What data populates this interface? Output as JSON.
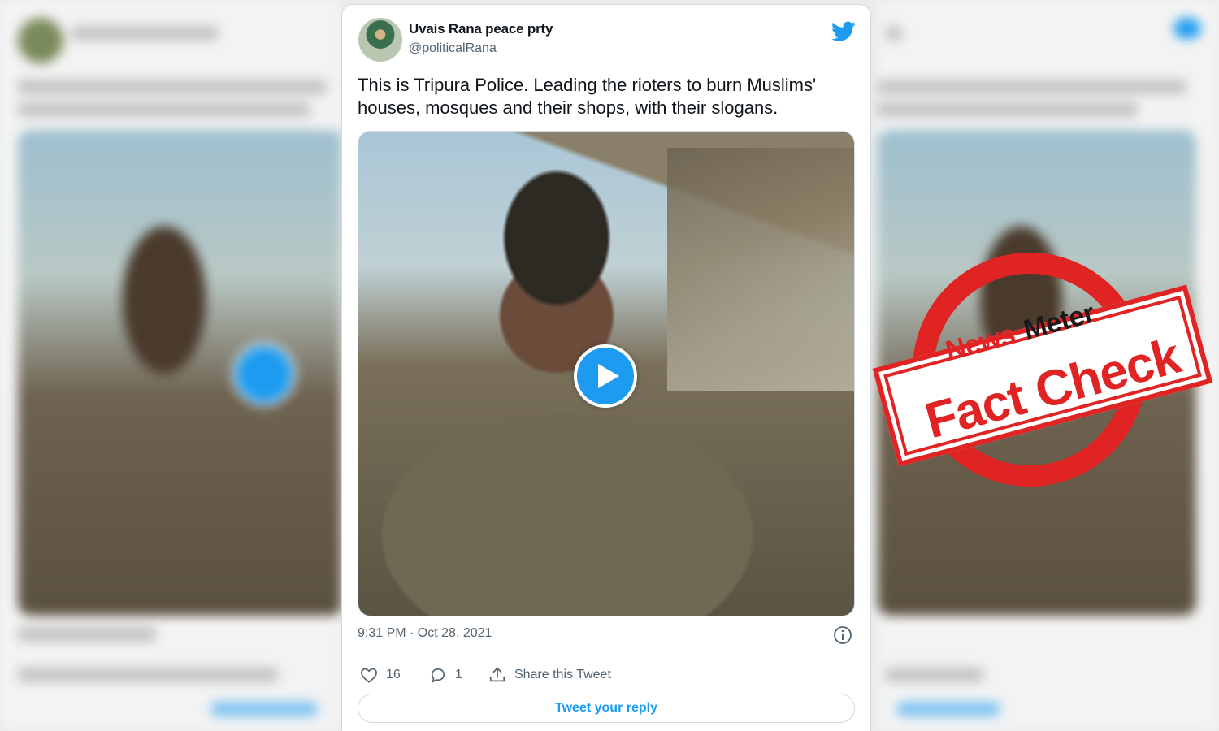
{
  "tweet": {
    "display_name": "Uvais Rana peace prty",
    "handle": "@politicalRana",
    "text": "This is Tripura Police. Leading the rioters to burn Muslims' houses, mosques and their shops, with their slogans.",
    "timestamp": "9:31 PM · Oct 28, 2021",
    "like_count": "16",
    "reply_count": "1",
    "share_label": "Share this Tweet",
    "reply_button_label": "Tweet your reply"
  },
  "stamp": {
    "brand_news": "News",
    "brand_meter": "Meter",
    "label": "Fact Check",
    "color": "#e02424"
  },
  "colors": {
    "twitter_blue": "#1d9bf0",
    "text_primary": "#0f1419",
    "text_secondary": "#536471"
  },
  "icons": [
    "twitter-bird-icon",
    "play-icon",
    "info-icon",
    "heart-icon",
    "reply-icon",
    "share-icon"
  ]
}
